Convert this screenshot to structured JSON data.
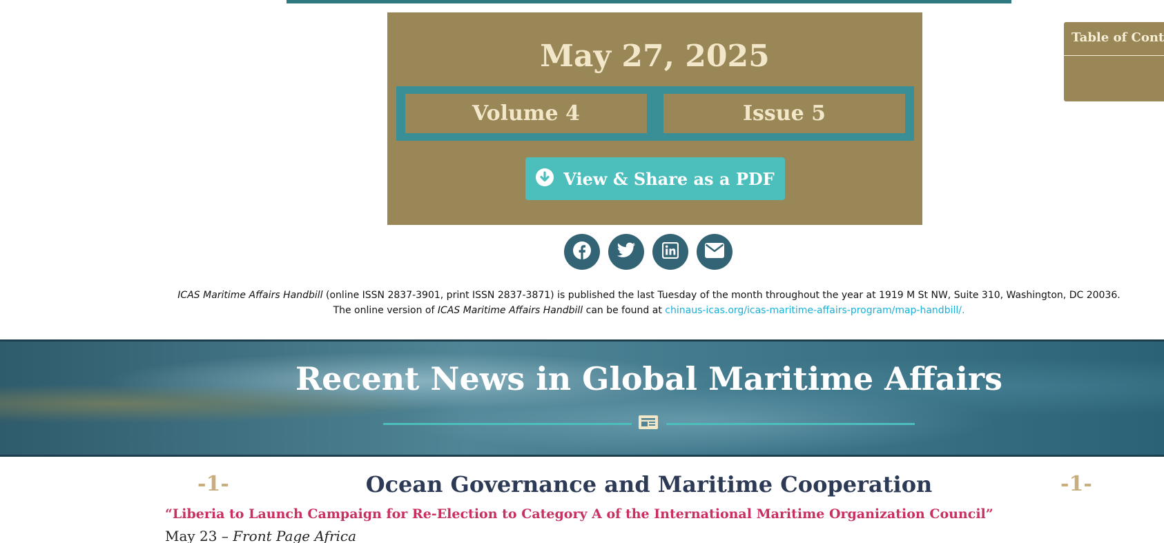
{
  "header": {
    "date": "May 27, 2025",
    "volume": "Volume 4",
    "issue": "Issue 5",
    "pdf_button": "View & Share as a PDF"
  },
  "share": {
    "icons": [
      "facebook-icon",
      "twitter-icon",
      "linkedin-icon",
      "email-icon"
    ]
  },
  "publication_note": {
    "line1_title": "ICAS Maritime Affairs Handbill",
    "line1_rest": " (online ISSN 2837-3901, print ISSN 2837-3871) is published the last Tuesday of the month throughout the year at 1919 M St NW, Suite 310, Washington, DC 20036.",
    "line2_prefix": "The online version of ",
    "line2_title": "ICAS Maritime Affairs Handbill",
    "line2_mid": " can be found at ",
    "line2_link": "chinaus-icas.org/icas-maritime-affairs-program/map-handbill/."
  },
  "news_banner": {
    "title": "Recent News in Global Maritime Affairs"
  },
  "section": {
    "number_left": "-1-",
    "number_right": "-1-",
    "title": "Ocean Governance and Maritime Cooperation"
  },
  "article": {
    "headline": "“Liberia to Launch Campaign for Re-Election to Category A of the International Maritime Organization Council”",
    "date": "May 23 – ",
    "source": "Front Page Africa"
  },
  "toc": {
    "title": "Table of Contents"
  },
  "colors": {
    "gold": "#9a8758",
    "teal": "#3a8f96",
    "button_teal": "#4cbfbd",
    "share_blue": "#336475",
    "headline_red": "#c7305f",
    "section_navy": "#2d3a55",
    "number_tan": "#c9ad7c"
  }
}
